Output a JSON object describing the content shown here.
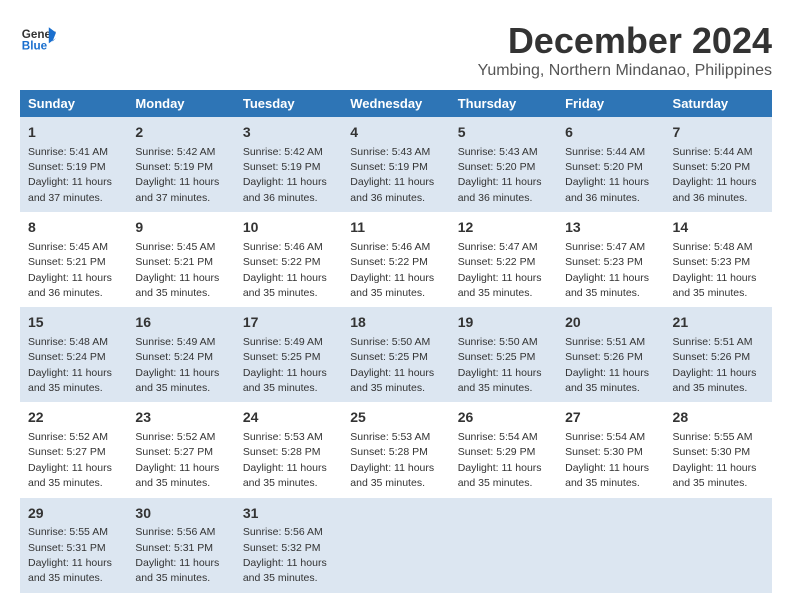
{
  "header": {
    "logo_line1": "General",
    "logo_line2": "Blue",
    "month": "December 2024",
    "location": "Yumbing, Northern Mindanao, Philippines"
  },
  "days_of_week": [
    "Sunday",
    "Monday",
    "Tuesday",
    "Wednesday",
    "Thursday",
    "Friday",
    "Saturday"
  ],
  "weeks": [
    [
      {
        "day": "1",
        "sunrise": "5:41 AM",
        "sunset": "5:19 PM",
        "daylight": "11 hours and 37 minutes."
      },
      {
        "day": "2",
        "sunrise": "5:42 AM",
        "sunset": "5:19 PM",
        "daylight": "11 hours and 37 minutes."
      },
      {
        "day": "3",
        "sunrise": "5:42 AM",
        "sunset": "5:19 PM",
        "daylight": "11 hours and 36 minutes."
      },
      {
        "day": "4",
        "sunrise": "5:43 AM",
        "sunset": "5:19 PM",
        "daylight": "11 hours and 36 minutes."
      },
      {
        "day": "5",
        "sunrise": "5:43 AM",
        "sunset": "5:20 PM",
        "daylight": "11 hours and 36 minutes."
      },
      {
        "day": "6",
        "sunrise": "5:44 AM",
        "sunset": "5:20 PM",
        "daylight": "11 hours and 36 minutes."
      },
      {
        "day": "7",
        "sunrise": "5:44 AM",
        "sunset": "5:20 PM",
        "daylight": "11 hours and 36 minutes."
      }
    ],
    [
      {
        "day": "8",
        "sunrise": "5:45 AM",
        "sunset": "5:21 PM",
        "daylight": "11 hours and 36 minutes."
      },
      {
        "day": "9",
        "sunrise": "5:45 AM",
        "sunset": "5:21 PM",
        "daylight": "11 hours and 35 minutes."
      },
      {
        "day": "10",
        "sunrise": "5:46 AM",
        "sunset": "5:22 PM",
        "daylight": "11 hours and 35 minutes."
      },
      {
        "day": "11",
        "sunrise": "5:46 AM",
        "sunset": "5:22 PM",
        "daylight": "11 hours and 35 minutes."
      },
      {
        "day": "12",
        "sunrise": "5:47 AM",
        "sunset": "5:22 PM",
        "daylight": "11 hours and 35 minutes."
      },
      {
        "day": "13",
        "sunrise": "5:47 AM",
        "sunset": "5:23 PM",
        "daylight": "11 hours and 35 minutes."
      },
      {
        "day": "14",
        "sunrise": "5:48 AM",
        "sunset": "5:23 PM",
        "daylight": "11 hours and 35 minutes."
      }
    ],
    [
      {
        "day": "15",
        "sunrise": "5:48 AM",
        "sunset": "5:24 PM",
        "daylight": "11 hours and 35 minutes."
      },
      {
        "day": "16",
        "sunrise": "5:49 AM",
        "sunset": "5:24 PM",
        "daylight": "11 hours and 35 minutes."
      },
      {
        "day": "17",
        "sunrise": "5:49 AM",
        "sunset": "5:25 PM",
        "daylight": "11 hours and 35 minutes."
      },
      {
        "day": "18",
        "sunrise": "5:50 AM",
        "sunset": "5:25 PM",
        "daylight": "11 hours and 35 minutes."
      },
      {
        "day": "19",
        "sunrise": "5:50 AM",
        "sunset": "5:25 PM",
        "daylight": "11 hours and 35 minutes."
      },
      {
        "day": "20",
        "sunrise": "5:51 AM",
        "sunset": "5:26 PM",
        "daylight": "11 hours and 35 minutes."
      },
      {
        "day": "21",
        "sunrise": "5:51 AM",
        "sunset": "5:26 PM",
        "daylight": "11 hours and 35 minutes."
      }
    ],
    [
      {
        "day": "22",
        "sunrise": "5:52 AM",
        "sunset": "5:27 PM",
        "daylight": "11 hours and 35 minutes."
      },
      {
        "day": "23",
        "sunrise": "5:52 AM",
        "sunset": "5:27 PM",
        "daylight": "11 hours and 35 minutes."
      },
      {
        "day": "24",
        "sunrise": "5:53 AM",
        "sunset": "5:28 PM",
        "daylight": "11 hours and 35 minutes."
      },
      {
        "day": "25",
        "sunrise": "5:53 AM",
        "sunset": "5:28 PM",
        "daylight": "11 hours and 35 minutes."
      },
      {
        "day": "26",
        "sunrise": "5:54 AM",
        "sunset": "5:29 PM",
        "daylight": "11 hours and 35 minutes."
      },
      {
        "day": "27",
        "sunrise": "5:54 AM",
        "sunset": "5:30 PM",
        "daylight": "11 hours and 35 minutes."
      },
      {
        "day": "28",
        "sunrise": "5:55 AM",
        "sunset": "5:30 PM",
        "daylight": "11 hours and 35 minutes."
      }
    ],
    [
      {
        "day": "29",
        "sunrise": "5:55 AM",
        "sunset": "5:31 PM",
        "daylight": "11 hours and 35 minutes."
      },
      {
        "day": "30",
        "sunrise": "5:56 AM",
        "sunset": "5:31 PM",
        "daylight": "11 hours and 35 minutes."
      },
      {
        "day": "31",
        "sunrise": "5:56 AM",
        "sunset": "5:32 PM",
        "daylight": "11 hours and 35 minutes."
      },
      {
        "day": "",
        "sunrise": "",
        "sunset": "",
        "daylight": ""
      },
      {
        "day": "",
        "sunrise": "",
        "sunset": "",
        "daylight": ""
      },
      {
        "day": "",
        "sunrise": "",
        "sunset": "",
        "daylight": ""
      },
      {
        "day": "",
        "sunrise": "",
        "sunset": "",
        "daylight": ""
      }
    ]
  ]
}
